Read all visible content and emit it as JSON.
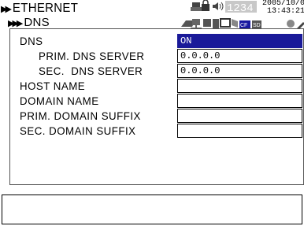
{
  "breadcrumb": {
    "level1": "ETHERNET",
    "level2": "DNS",
    "level1_arrows": "▶▶",
    "level2_arrows": "▶▶▶"
  },
  "status": {
    "counter": "1234",
    "date": "2005/10/02",
    "time": "13:43:21",
    "cf_label": "CF",
    "sd_label": "SD",
    "icons": [
      "printer-icon",
      "lock-icon",
      "speaker-icon",
      "network-icon",
      "keyboard-icon",
      "monitor-icon",
      "cf-card-icon",
      "sd-card-icon",
      "tool-icon"
    ]
  },
  "form": {
    "rows": [
      {
        "label": "DNS",
        "value": "ON",
        "selected": true
      },
      {
        "label": "PRIM. DNS SERVER",
        "value": "0.0.0.0"
      },
      {
        "label": "SEC.  DNS SERVER",
        "value": "0.0.0.0"
      },
      {
        "label": "HOST NAME",
        "value": ""
      },
      {
        "label": "DOMAIN NAME",
        "value": ""
      },
      {
        "label": "PRIM. DOMAIN SUFFIX",
        "value": ""
      },
      {
        "label": "SEC. DOMAIN SUFFIX",
        "value": ""
      }
    ]
  },
  "message": "",
  "colors": {
    "selected_bg": "#1a1a99",
    "selected_fg": "#ffffff"
  }
}
